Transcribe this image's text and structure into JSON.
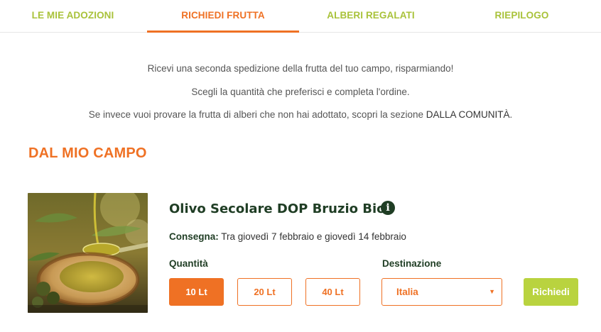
{
  "tabs": [
    {
      "label": "LE MIE ADOZIONI",
      "active": false
    },
    {
      "label": "RICHIEDI FRUTTA",
      "active": true
    },
    {
      "label": "ALBERI REGALATI",
      "active": false
    },
    {
      "label": "RIEPILOGO",
      "active": false
    }
  ],
  "intro": {
    "line1": "Ricevi una seconda spedizione della frutta del tuo campo, risparmiando!",
    "line2": "Scegli la quantità che preferisci e completa l'ordine.",
    "line3_prefix": "Se invece vuoi provare la frutta di alberi che non hai adottato, scopri la sezione ",
    "line3_link": "DALLA COMUNITÀ",
    "line3_suffix": "."
  },
  "section": {
    "title": "DAL MIO CAMPO"
  },
  "product": {
    "name": "Olivo Secolare DOP Bruzio Bio",
    "info_icon": "info-circle-icon",
    "delivery_label": "Consegna:",
    "delivery_text": " Tra giovedì 7 febbraio e giovedì 14 febbraio",
    "quantity_label": "Quantità",
    "quantities": [
      "10 Lt",
      "20 Lt",
      "40 Lt"
    ],
    "selected_quantity": "10 Lt",
    "destination_label": "Destinazione",
    "destination_value": "Italia",
    "request_label": "Richiedi"
  },
  "colors": {
    "accent_orange": "#ef7124",
    "accent_green": "#b9d33f",
    "tab_green": "#a9c23a",
    "dark_green": "#1f3d24"
  }
}
